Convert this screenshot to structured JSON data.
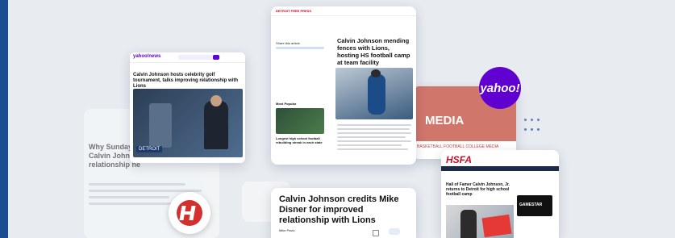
{
  "colors": {
    "yahoo": "#6001d2",
    "hsfa": "#c8102e",
    "freep": "#d0021b",
    "media_bg": "#c0483a"
  },
  "cards": {
    "yahoo_news": {
      "site": "yahoo/news",
      "headline": "Calvin Johnson hosts celebrity golf tournament, talks improving relationship with Lions",
      "video_caption": "DETROIT"
    },
    "freep": {
      "site": "DETROIT FREE PRESS",
      "share_label": "Share this article",
      "headline": "Calvin Johnson mending fences with Lions, hosting HS football camp at team facility",
      "most_popular": "Most Popular",
      "popular_item": "Longest high school football rebuilding streak in each state"
    },
    "ghost_left": {
      "headline": "Why Sunday Calvin Johnson relationship he"
    },
    "media": {
      "label": "MEDIA",
      "nav": "BASKETBALL  FOOTBALL  COLLEGE  MEDIA"
    },
    "hsfa": {
      "logo": "HSFA",
      "headline": "Hall of Famer Calvin Johnson, Jr. returns to Detroit for high school football camp",
      "ad_text": "GAMESTAR"
    },
    "bottom": {
      "headline": "Calvin Johnson credits Mike Disner for improved relationship with Lions",
      "byline": "Mike Pavlo"
    }
  },
  "logos": {
    "yahoo": "yahoo!"
  }
}
